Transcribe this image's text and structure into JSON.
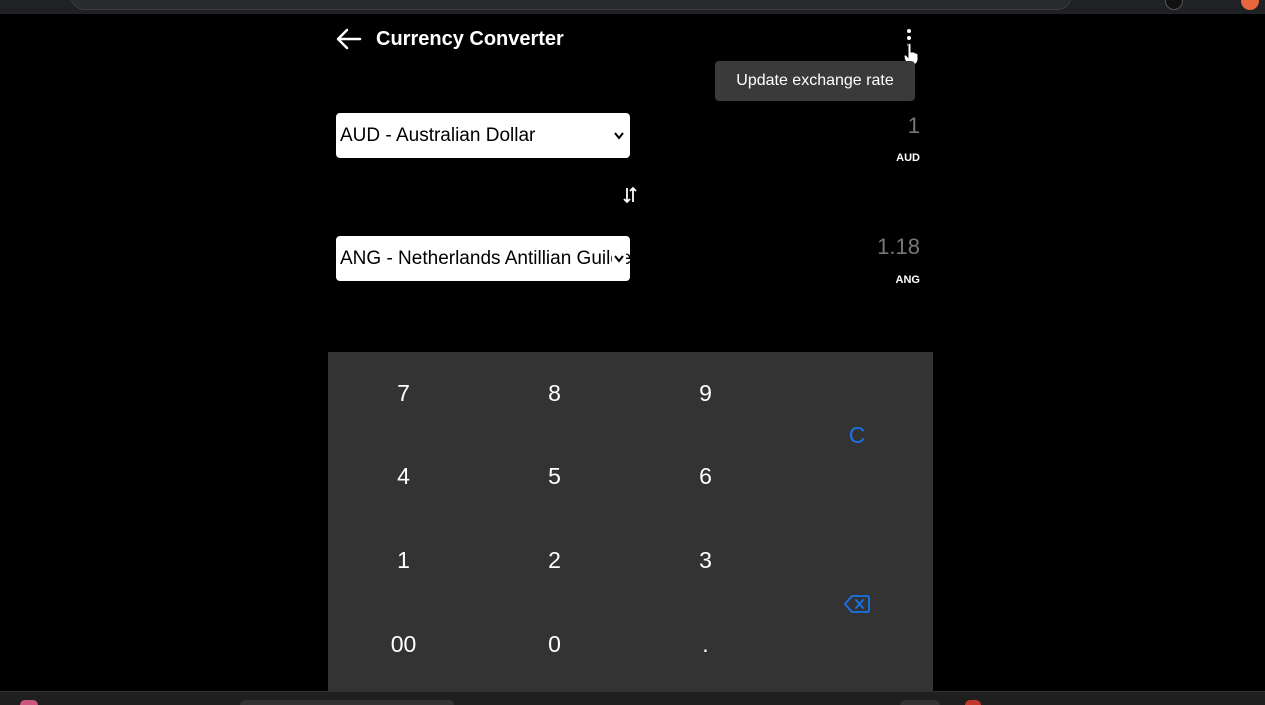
{
  "app": {
    "title": "Currency Converter",
    "menu_tooltip": "Update exchange rate"
  },
  "from": {
    "selected": "AUD - Australian Dollar",
    "amount": "1",
    "code": "AUD"
  },
  "to": {
    "selected": "ANG - Netherlands Antillian Guilder",
    "amount": "1.18",
    "code": "ANG"
  },
  "keypad": {
    "keys": [
      "7",
      "8",
      "9",
      "4",
      "5",
      "6",
      "1",
      "2",
      "3",
      "00",
      "0",
      "."
    ],
    "clear": "C"
  },
  "colors": {
    "background": "#000000",
    "keypad_bg": "#333333",
    "accent": "#1a73e8",
    "tooltip_bg": "#3a3a3a"
  },
  "icons": {
    "back": "arrow-left-icon",
    "menu": "more-vertical-icon",
    "swap": "swap-vertical-icon",
    "backspace": "backspace-icon"
  }
}
